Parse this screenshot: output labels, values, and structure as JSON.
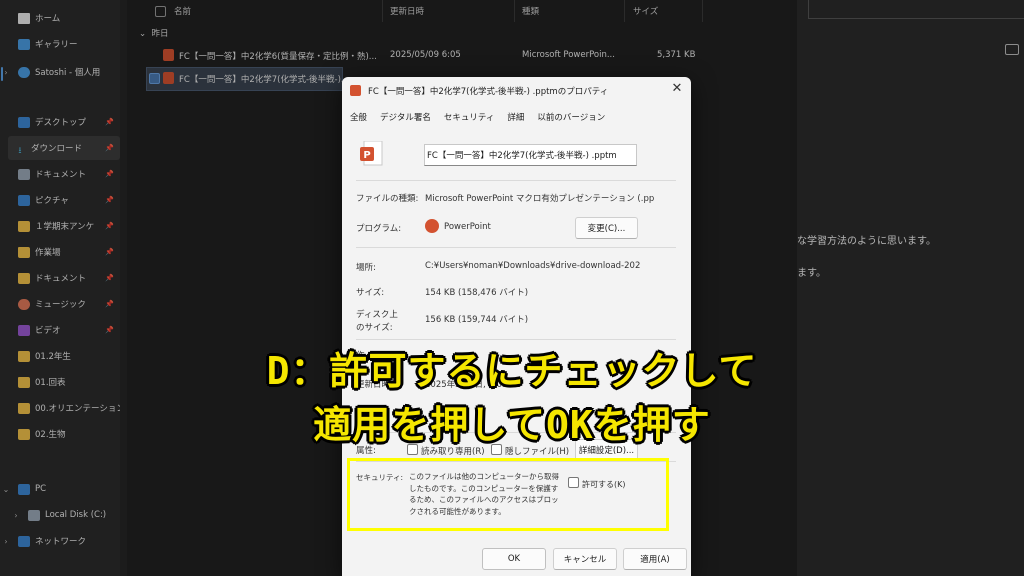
{
  "sidebar": {
    "items": [
      {
        "label": "ホーム",
        "icon": "home-icon"
      },
      {
        "label": "ギャラリー",
        "icon": "gallery-icon"
      },
      {
        "label": "Satoshi - 個人用",
        "icon": "cloud-icon"
      },
      {
        "label": "デスクトップ",
        "icon": "desktop-icon"
      },
      {
        "label": "ダウンロード",
        "icon": "download-icon"
      },
      {
        "label": "ドキュメント",
        "icon": "document-icon"
      },
      {
        "label": "ピクチャ",
        "icon": "pictures-icon"
      },
      {
        "label": "１学期末アンケ",
        "icon": "folder-icon"
      },
      {
        "label": "作業場",
        "icon": "folder-icon"
      },
      {
        "label": "ドキュメント",
        "icon": "folder-icon"
      },
      {
        "label": "ミュージック",
        "icon": "music-icon"
      },
      {
        "label": "ビデオ",
        "icon": "video-icon"
      },
      {
        "label": "01.2年生",
        "icon": "folder-icon"
      },
      {
        "label": "01.回表",
        "icon": "folder-icon"
      },
      {
        "label": "00.オリエンテーション",
        "icon": "folder-icon"
      },
      {
        "label": "02.生物",
        "icon": "folder-icon"
      },
      {
        "label": "PC",
        "icon": "pc-icon"
      },
      {
        "label": "Local Disk (C:)",
        "icon": "disk-icon"
      },
      {
        "label": "ネットワーク",
        "icon": "network-icon"
      }
    ],
    "pin_glyph": "📌"
  },
  "filelist": {
    "columns": [
      "名前",
      "更新日時",
      "種類",
      "サイズ"
    ],
    "group_label": "昨日",
    "rows": [
      {
        "name": "FC【一問一答】中2化学6(質量保存・定比例・熱)...",
        "date": "2025/05/09 6:05",
        "type": "Microsoft PowerPoin...",
        "size": "5,371 KB"
      },
      {
        "name": "FC【一問一答】中2化学7(化学式-後半戦-)...",
        "date": "",
        "type": "",
        "size": ""
      }
    ]
  },
  "rightpane": {
    "line1": "な学習方法のように思います。",
    "line2": "ます。"
  },
  "dialog": {
    "title": "FC【一問一答】中2化学7(化学式-後半戦-) .pptmのプロパティ",
    "close": "✕",
    "tabs": [
      "全般",
      "デジタル署名",
      "セキュリティ",
      "詳細",
      "以前のバージョン"
    ],
    "filename": "FC【一問一答】中2化学7(化学式-後半戦-) .pptm",
    "file_type_label": "ファイルの種類:",
    "file_type": "Microsoft PowerPoint マクロ有効プレゼンテーション (.pp",
    "program_label": "プログラム:",
    "program": "PowerPoint",
    "change_button": "変更(C)...",
    "location_label": "場所:",
    "location": "C:¥Users¥noman¥Downloads¥drive-download-202",
    "size_label": "サイズ:",
    "size": "154 KB (158,476 バイト)",
    "disk_size_label_1": "ディスク上",
    "disk_size_label_2": "のサイズ:",
    "disk_size": "156 KB (159,744 バイト)",
    "created_label": "作",
    "modified_label": "更新日時:",
    "modified": "2025年5月9日, 6:05:58",
    "attr_label": "属性:",
    "readonly": "読み取り専用(R)",
    "hidden": "隠しファイル(H)",
    "advanced_button": "詳細設定(D)...",
    "security_label": "セキュリティ:",
    "security_text": [
      "このファイルは他のコンピューターから取得",
      "したものです。このコンピューターを保護す",
      "るため、このファイルへのアクセスはブロッ",
      "クされる可能性があります。"
    ],
    "allow": "許可する(K)",
    "ok": "OK",
    "cancel": "キャンセル",
    "apply": "適用(A)"
  },
  "caption": {
    "line1": "D：許可するにチェックして",
    "line2": "適用を押してOKを押す",
    "color": "#f5e600"
  }
}
